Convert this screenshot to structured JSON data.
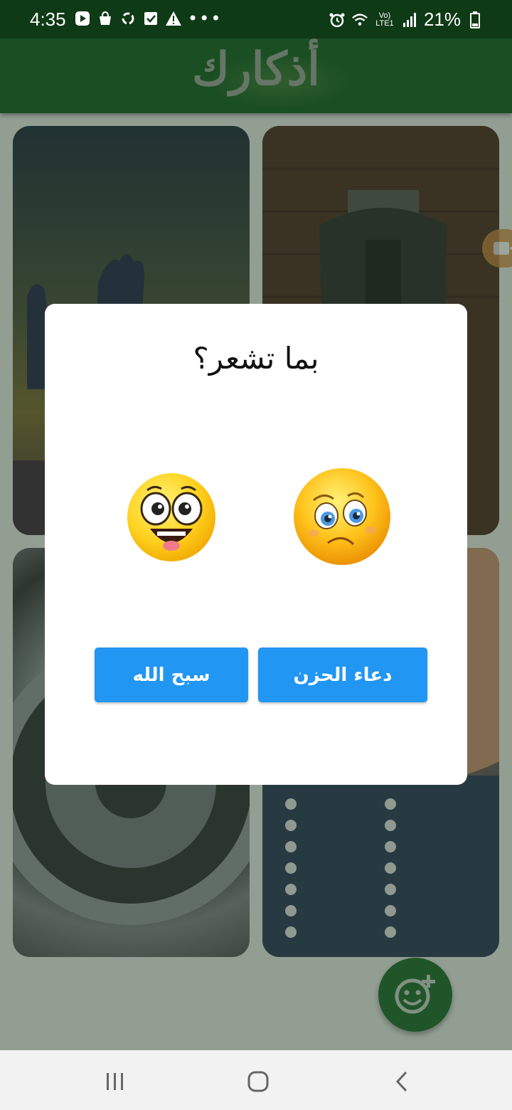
{
  "status_bar": {
    "time": "4:35",
    "battery_percent": "21%",
    "network_label": "Vo) LTE1",
    "left_icons": [
      "play-store-icon",
      "bag-icon",
      "sync-icon",
      "checkbox-icon",
      "warning-icon"
    ],
    "more": "•••",
    "right_icons": [
      "alarm-icon",
      "wifi-icon",
      "signal-icon",
      "battery-icon"
    ]
  },
  "app_bar": {
    "title": "أذكارك"
  },
  "dialog": {
    "title": "بما تشعر؟",
    "emojis": [
      "happy-face-icon",
      "sad-face-icon"
    ],
    "buttons": {
      "left": "سبح الله",
      "right": "دعاء الحزن"
    }
  },
  "fab": {
    "icon": "add-emoji-icon"
  },
  "nav_bar": {
    "items": [
      "recent-apps-icon",
      "home-icon",
      "back-icon"
    ]
  },
  "colors": {
    "status_bar": "#0f3a16",
    "app_bar": "#0f5e1f",
    "button": "#2196f3",
    "fab": "#1b6b2a"
  }
}
